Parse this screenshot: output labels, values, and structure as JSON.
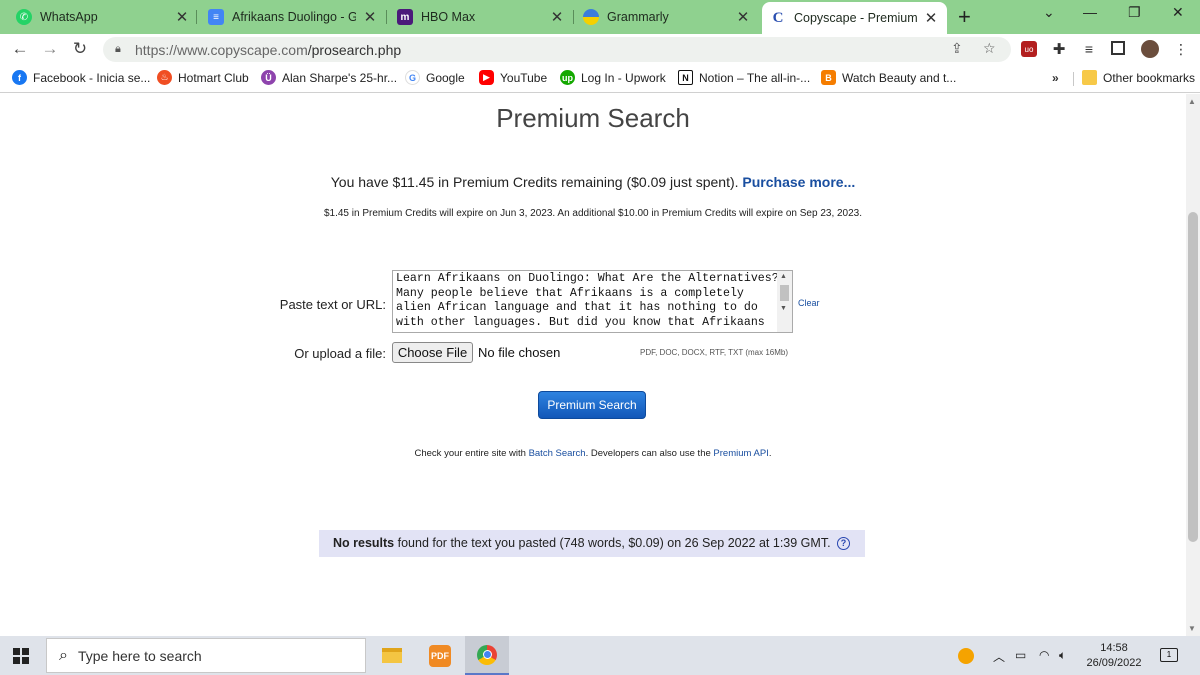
{
  "browser": {
    "tabs": [
      {
        "title": "WhatsApp",
        "icon": "whatsapp-icon"
      },
      {
        "title": "Afrikaans Duolingo - Goo",
        "icon": "google-docs-icon"
      },
      {
        "title": "HBO Max",
        "icon": "hbo-max-icon"
      },
      {
        "title": "Grammarly",
        "icon": "grammarly-icon"
      },
      {
        "title": "Copyscape - Premium Sea",
        "icon": "copyscape-icon",
        "active": true
      }
    ],
    "url_domain": "https://www.copyscape.com",
    "url_path": "/prosearch.php",
    "bookmarks": [
      {
        "label": "Facebook - Inicia se...",
        "icon": "facebook-icon"
      },
      {
        "label": "Hotmart Club",
        "icon": "hotmart-icon"
      },
      {
        "label": "Alan Sharpe's 25-hr...",
        "icon": "alan-sharpe-icon"
      },
      {
        "label": "Google",
        "icon": "google-icon"
      },
      {
        "label": "YouTube",
        "icon": "youtube-icon"
      },
      {
        "label": "Log In - Upwork",
        "icon": "upwork-icon"
      },
      {
        "label": "Notion – The all-in-...",
        "icon": "notion-icon"
      },
      {
        "label": "Watch Beauty and t...",
        "icon": "blogger-icon"
      }
    ],
    "bookmarks_overflow": "»",
    "other_bookmarks": "Other bookmarks"
  },
  "page": {
    "title": "Premium Search",
    "credits_text": "You have $11.45 in Premium Credits remaining ($0.09 just spent).",
    "purchase_link": "Purchase more...",
    "expiry_text": "$1.45 in Premium Credits will expire on Jun 3, 2023. An additional $10.00 in Premium Credits will expire on Sep 23, 2023.",
    "paste_label": "Paste text or URL:",
    "textarea_value": "Learn Afrikaans on Duolingo: What Are the Alternatives?\nMany people believe that Afrikaans is a completely\nalien African language and that it has nothing to do\nwith other languages. But did you know that Afrikaans",
    "clear_label": "Clear",
    "upload_label": "Or upload a file:",
    "choose_file_label": "Choose File",
    "no_file_label": "No file chosen",
    "formats_text": "PDF, DOC, DOCX, RTF, TXT (max 16Mb)",
    "search_button": "Premium Search",
    "info_prefix": "Check your entire site with",
    "batch_link": "Batch Search",
    "info_middle": ". Developers can also use the",
    "api_link": "Premium API",
    "info_suffix": ".",
    "result_bold": "No results",
    "result_text": "found for the text you pasted (748 words, $0.09) on 26 Sep 2022 at 1:39 GMT.",
    "result_help": "?"
  },
  "taskbar": {
    "search_placeholder": "Type here to search",
    "time": "14:58",
    "date": "26/09/2022",
    "notification_count": "1"
  },
  "colors": {
    "tabstrip": "#8fd18f",
    "link": "#1a4fa0",
    "button": "#1f6fd0",
    "result_bg": "#e2e3f5"
  }
}
